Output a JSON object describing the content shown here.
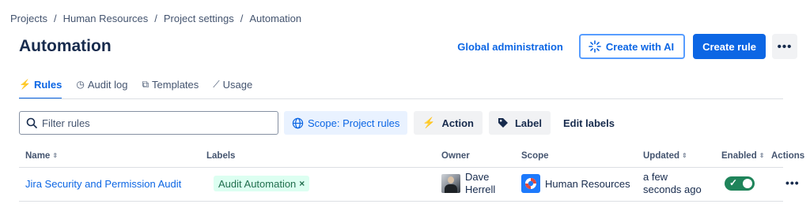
{
  "breadcrumb": [
    "Projects",
    "Human Resources",
    "Project settings",
    "Automation"
  ],
  "page_title": "Automation",
  "header": {
    "global_admin": "Global administration",
    "create_ai": "Create with AI",
    "create_rule": "Create rule",
    "more": "•••"
  },
  "tabs": [
    {
      "label": "Rules",
      "icon": "⚡"
    },
    {
      "label": "Audit log",
      "icon": "◷"
    },
    {
      "label": "Templates",
      "icon": "⧉"
    },
    {
      "label": "Usage",
      "icon": "⟋"
    }
  ],
  "toolbar": {
    "search_placeholder": "Filter rules",
    "scope": "Scope: Project rules",
    "action": "Action",
    "label": "Label",
    "edit_labels": "Edit labels"
  },
  "table": {
    "headers": [
      "Name",
      "Labels",
      "Owner",
      "Scope",
      "Updated",
      "Enabled",
      "Actions"
    ],
    "rows": [
      {
        "name": "Jira Security and Permission Audit",
        "label": "Audit Automation",
        "label_remove": "×",
        "owner_first": "Dave",
        "owner_last": "Herrell",
        "scope": "Human Resources",
        "updated_1": "a few",
        "updated_2": "seconds ago",
        "enabled": true,
        "more": "•••"
      }
    ]
  },
  "colors": {
    "accent": "#0c66e4",
    "toggle_on": "#1f845a",
    "label_bg": "#dcfff1",
    "label_text": "#216e4e"
  }
}
